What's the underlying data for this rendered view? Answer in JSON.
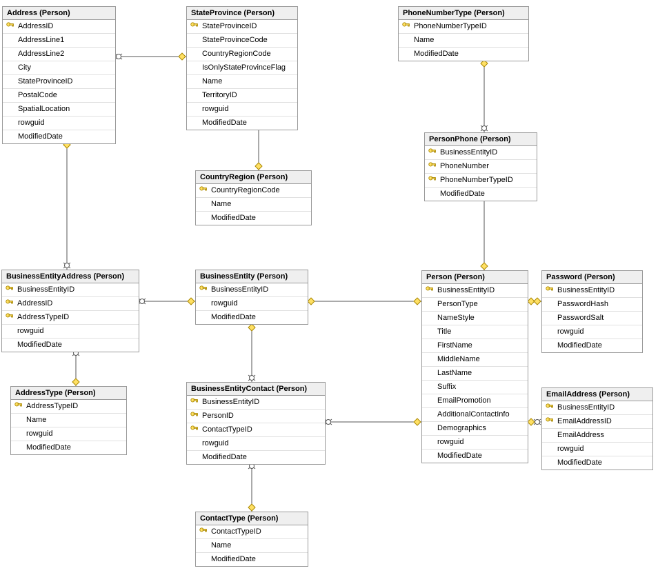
{
  "tables": {
    "address": {
      "title": "Address (Person)",
      "cols": [
        {
          "n": "AddressID",
          "k": true
        },
        {
          "n": "AddressLine1"
        },
        {
          "n": "AddressLine2"
        },
        {
          "n": "City"
        },
        {
          "n": "StateProvinceID"
        },
        {
          "n": "PostalCode"
        },
        {
          "n": "SpatialLocation"
        },
        {
          "n": "rowguid"
        },
        {
          "n": "ModifiedDate"
        }
      ]
    },
    "stateprovince": {
      "title": "StateProvince (Person)",
      "cols": [
        {
          "n": "StateProvinceID",
          "k": true
        },
        {
          "n": "StateProvinceCode"
        },
        {
          "n": "CountryRegionCode"
        },
        {
          "n": "IsOnlyStateProvinceFlag"
        },
        {
          "n": "Name"
        },
        {
          "n": "TerritoryID"
        },
        {
          "n": "rowguid"
        },
        {
          "n": "ModifiedDate"
        }
      ]
    },
    "phonenumbertype": {
      "title": "PhoneNumberType (Person)",
      "cols": [
        {
          "n": "PhoneNumberTypeID",
          "k": true
        },
        {
          "n": "Name"
        },
        {
          "n": "ModifiedDate"
        }
      ]
    },
    "countryregion": {
      "title": "CountryRegion (Person)",
      "cols": [
        {
          "n": "CountryRegionCode",
          "k": true
        },
        {
          "n": "Name"
        },
        {
          "n": "ModifiedDate"
        }
      ]
    },
    "personphone": {
      "title": "PersonPhone (Person)",
      "cols": [
        {
          "n": "BusinessEntityID",
          "k": true
        },
        {
          "n": "PhoneNumber",
          "k": true
        },
        {
          "n": "PhoneNumberTypeID",
          "k": true
        },
        {
          "n": "ModifiedDate"
        }
      ]
    },
    "businessentityaddress": {
      "title": "BusinessEntityAddress (Person)",
      "cols": [
        {
          "n": "BusinessEntityID",
          "k": true
        },
        {
          "n": "AddressID",
          "k": true
        },
        {
          "n": "AddressTypeID",
          "k": true
        },
        {
          "n": "rowguid"
        },
        {
          "n": "ModifiedDate"
        }
      ]
    },
    "businessentity": {
      "title": "BusinessEntity (Person)",
      "cols": [
        {
          "n": "BusinessEntityID",
          "k": true
        },
        {
          "n": "rowguid"
        },
        {
          "n": "ModifiedDate"
        }
      ]
    },
    "person": {
      "title": "Person (Person)",
      "cols": [
        {
          "n": "BusinessEntityID",
          "k": true
        },
        {
          "n": "PersonType"
        },
        {
          "n": "NameStyle"
        },
        {
          "n": "Title"
        },
        {
          "n": "FirstName"
        },
        {
          "n": "MiddleName"
        },
        {
          "n": "LastName"
        },
        {
          "n": "Suffix"
        },
        {
          "n": "EmailPromotion"
        },
        {
          "n": "AdditionalContactInfo"
        },
        {
          "n": "Demographics"
        },
        {
          "n": "rowguid"
        },
        {
          "n": "ModifiedDate"
        }
      ]
    },
    "password": {
      "title": "Password (Person)",
      "cols": [
        {
          "n": "BusinessEntityID",
          "k": true
        },
        {
          "n": "PasswordHash"
        },
        {
          "n": "PasswordSalt"
        },
        {
          "n": "rowguid"
        },
        {
          "n": "ModifiedDate"
        }
      ]
    },
    "addresstype": {
      "title": "AddressType (Person)",
      "cols": [
        {
          "n": "AddressTypeID",
          "k": true
        },
        {
          "n": "Name"
        },
        {
          "n": "rowguid"
        },
        {
          "n": "ModifiedDate"
        }
      ]
    },
    "businessentitycontact": {
      "title": "BusinessEntityContact (Person)",
      "cols": [
        {
          "n": "BusinessEntityID",
          "k": true
        },
        {
          "n": "PersonID",
          "k": true
        },
        {
          "n": "ContactTypeID",
          "k": true
        },
        {
          "n": "rowguid"
        },
        {
          "n": "ModifiedDate"
        }
      ]
    },
    "emailaddress": {
      "title": "EmailAddress (Person)",
      "cols": [
        {
          "n": "BusinessEntityID",
          "k": true
        },
        {
          "n": "EmailAddressID",
          "k": true
        },
        {
          "n": "EmailAddress"
        },
        {
          "n": "rowguid"
        },
        {
          "n": "ModifiedDate"
        }
      ]
    },
    "contacttype": {
      "title": "ContactType (Person)",
      "cols": [
        {
          "n": "ContactTypeID",
          "k": true
        },
        {
          "n": "Name"
        },
        {
          "n": "ModifiedDate"
        }
      ]
    }
  }
}
